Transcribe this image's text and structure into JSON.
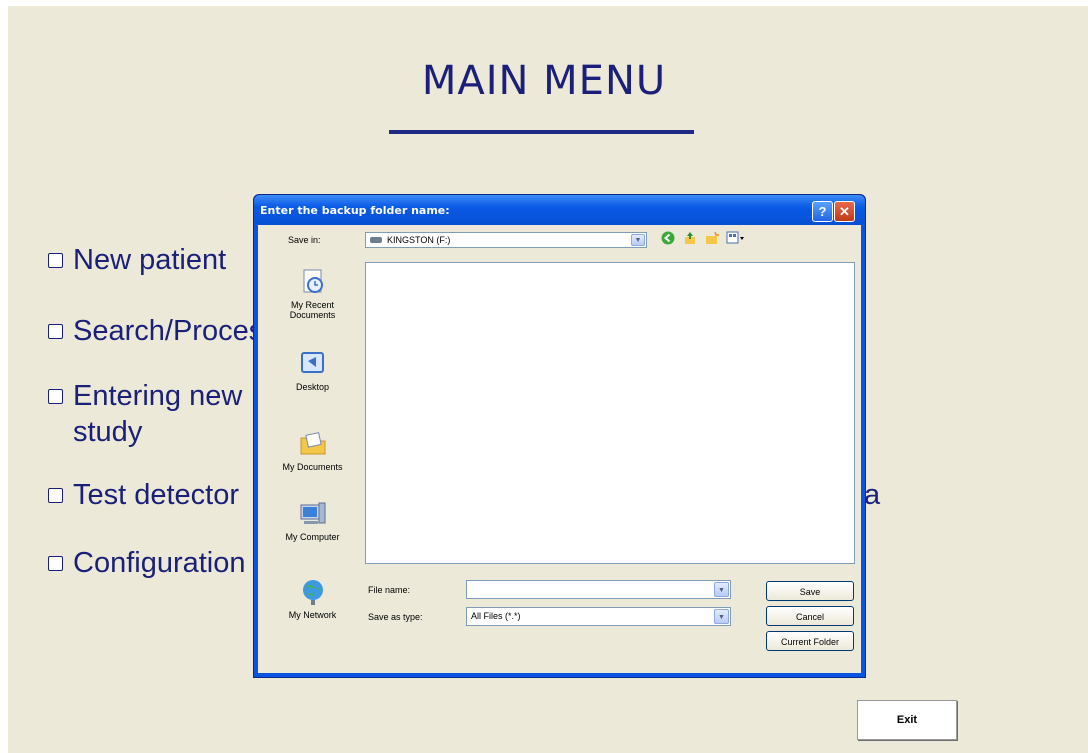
{
  "main": {
    "title": "MAIN MENU",
    "menu_items": [
      {
        "label": "New patient"
      },
      {
        "label": "Search/Process"
      },
      {
        "label": "Entering new\nstudy"
      },
      {
        "label": "Test detector"
      },
      {
        "label": "Configuration"
      }
    ],
    "menu_trailing_glyph": "a",
    "exit_label": "Exit"
  },
  "dialog": {
    "title": "Enter the backup folder name:",
    "help_label": "?",
    "close_label": "✕",
    "save_in_label": "Save in:",
    "save_in_value": "KINGSTON (F:)",
    "places": [
      {
        "label": "My Recent\nDocuments",
        "icon": "recent-documents-icon"
      },
      {
        "label": "Desktop",
        "icon": "desktop-icon"
      },
      {
        "label": "My Documents",
        "icon": "my-documents-icon"
      },
      {
        "label": "My Computer",
        "icon": "my-computer-icon"
      },
      {
        "label": "My Network",
        "icon": "my-network-icon"
      }
    ],
    "file_name_label": "File name:",
    "file_name_value": "",
    "save_as_type_label": "Save as type:",
    "save_as_type_value": "All Files (*.*)",
    "save_label": "Save",
    "cancel_label": "Cancel",
    "current_folder_label": "Current Folder"
  },
  "colors": {
    "menu_text": "#1a1f78",
    "background": "#ece9d8",
    "dialog_frame": "#0b54e2"
  }
}
